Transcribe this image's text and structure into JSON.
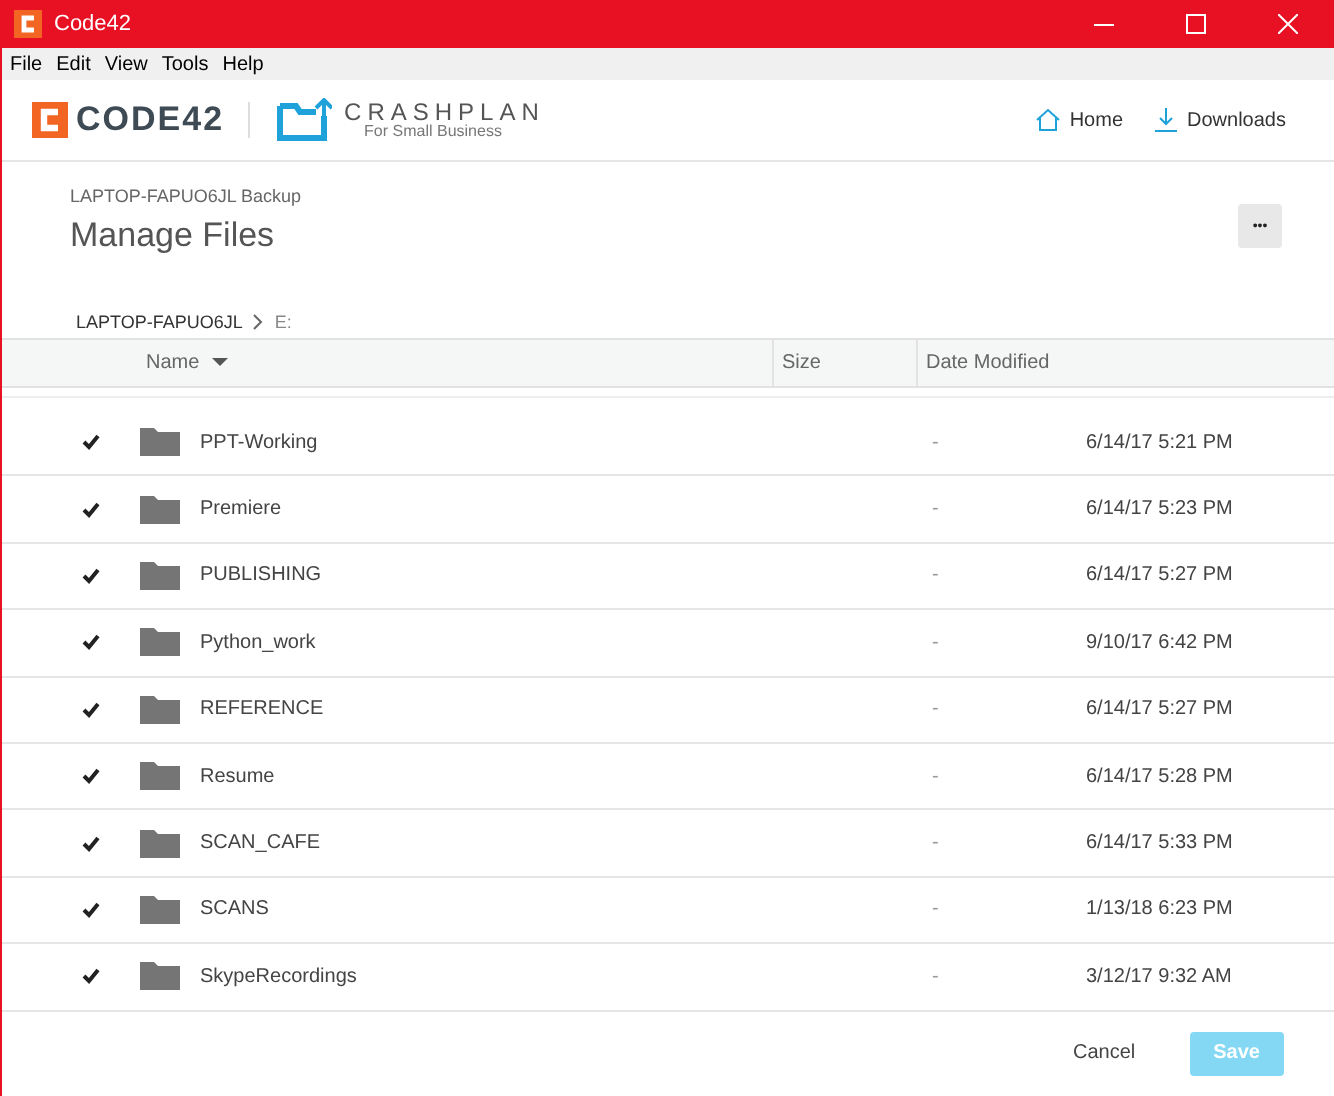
{
  "window": {
    "title": "Code42"
  },
  "menu": [
    "File",
    "Edit",
    "View",
    "Tools",
    "Help"
  ],
  "header": {
    "brand": "CODE42",
    "product": "CRASHPLAN",
    "product_sub": "For Small Business",
    "nav": [
      {
        "label": "Home",
        "kind": "home"
      },
      {
        "label": "Downloads",
        "kind": "download"
      }
    ]
  },
  "page": {
    "subtitle": "LAPTOP-FAPUO6JL Backup",
    "title": "Manage Files",
    "more": "•••"
  },
  "breadcrumb": [
    "LAPTOP-FAPUO6JL",
    "E:"
  ],
  "table": {
    "columns": [
      "Name",
      "Size",
      "Date Modified"
    ],
    "rows": [
      {
        "checked": true,
        "name": "PPT-Working",
        "size": "-",
        "date": "6/14/17 5:21 PM"
      },
      {
        "checked": true,
        "name": "Premiere",
        "size": "-",
        "date": "6/14/17 5:23 PM"
      },
      {
        "checked": true,
        "name": "PUBLISHING",
        "size": "-",
        "date": "6/14/17 5:27 PM"
      },
      {
        "checked": true,
        "name": "Python_work",
        "size": "-",
        "date": "9/10/17 6:42 PM"
      },
      {
        "checked": true,
        "name": "REFERENCE",
        "size": "-",
        "date": "6/14/17 5:27 PM"
      },
      {
        "checked": true,
        "name": "Resume",
        "size": "-",
        "date": "6/14/17 5:28 PM"
      },
      {
        "checked": true,
        "name": "SCAN_CAFE",
        "size": "-",
        "date": "6/14/17 5:33 PM"
      },
      {
        "checked": true,
        "name": "SCANS",
        "size": "-",
        "date": "1/13/18 6:23 PM"
      },
      {
        "checked": true,
        "name": "SkypeRecordings",
        "size": "-",
        "date": "3/12/17 9:32 AM"
      }
    ]
  },
  "buttons": [
    {
      "label": "Cancel",
      "kind": "link",
      "disabled": false
    },
    {
      "label": "Save",
      "kind": "primary",
      "disabled": true
    }
  ]
}
